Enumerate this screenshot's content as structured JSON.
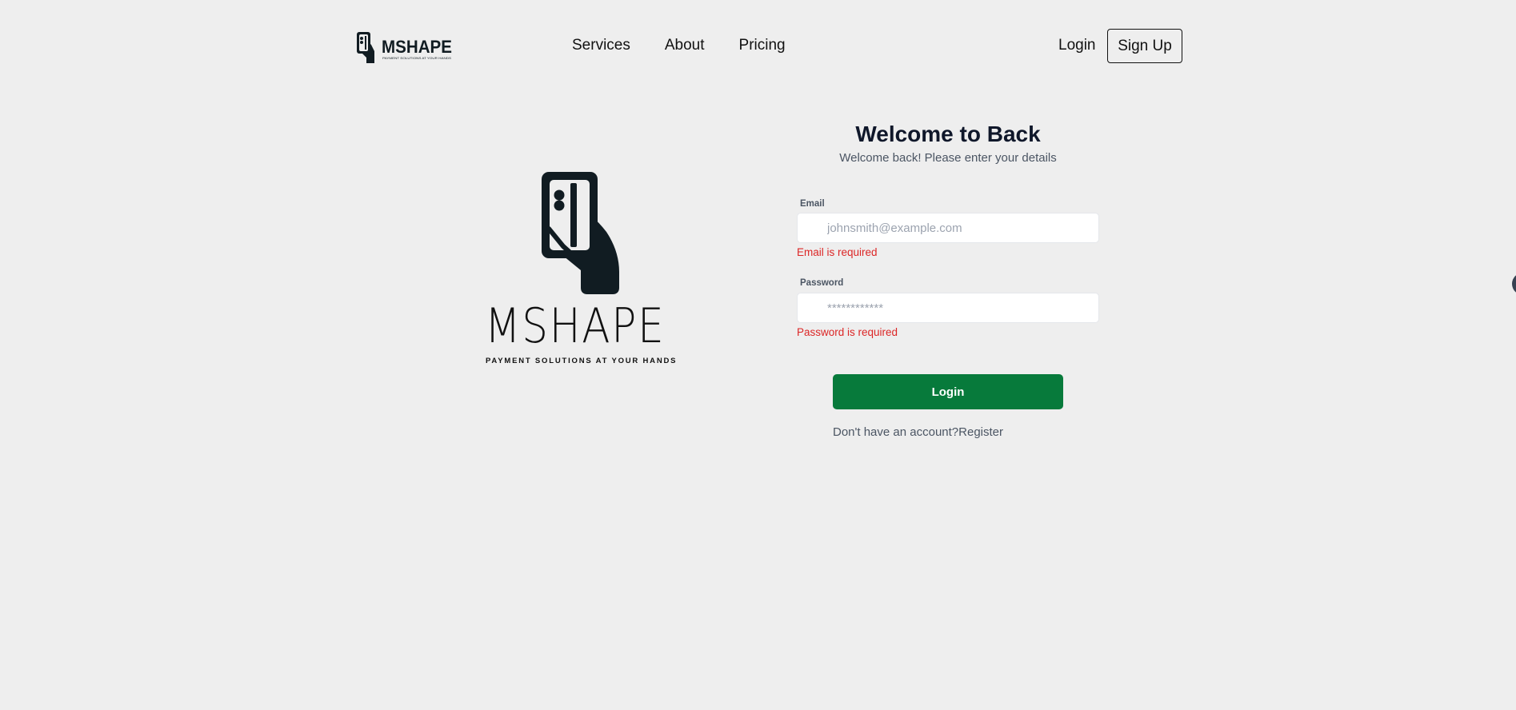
{
  "header": {
    "logo_text": "MSHAPE",
    "logo_tagline": "PAYMENT SOLUTIONS AT YOUR HANDS",
    "nav": [
      "Services",
      "About",
      "Pricing"
    ],
    "login_label": "Login",
    "signup_label": "Sign Up"
  },
  "brand": {
    "name": "MSHAPE",
    "tagline": "PAYMENT SOLUTIONS AT YOUR HANDS"
  },
  "form": {
    "title": "Welcome to Back",
    "subtitle": "Welcome back! Please enter your details",
    "email_label": "Email",
    "email_placeholder": "johnsmith@example.com",
    "email_value": "",
    "email_error": "Email is required",
    "password_label": "Password",
    "password_placeholder": "************",
    "password_value": "",
    "password_error": "Password is required",
    "submit_label": "Login",
    "no_account_text": "Don't have an account?",
    "register_label": "Register"
  },
  "colors": {
    "background": "#eeeeee",
    "primary_button": "#077a3b",
    "error": "#dc2626",
    "logo_dark": "#111c22"
  }
}
